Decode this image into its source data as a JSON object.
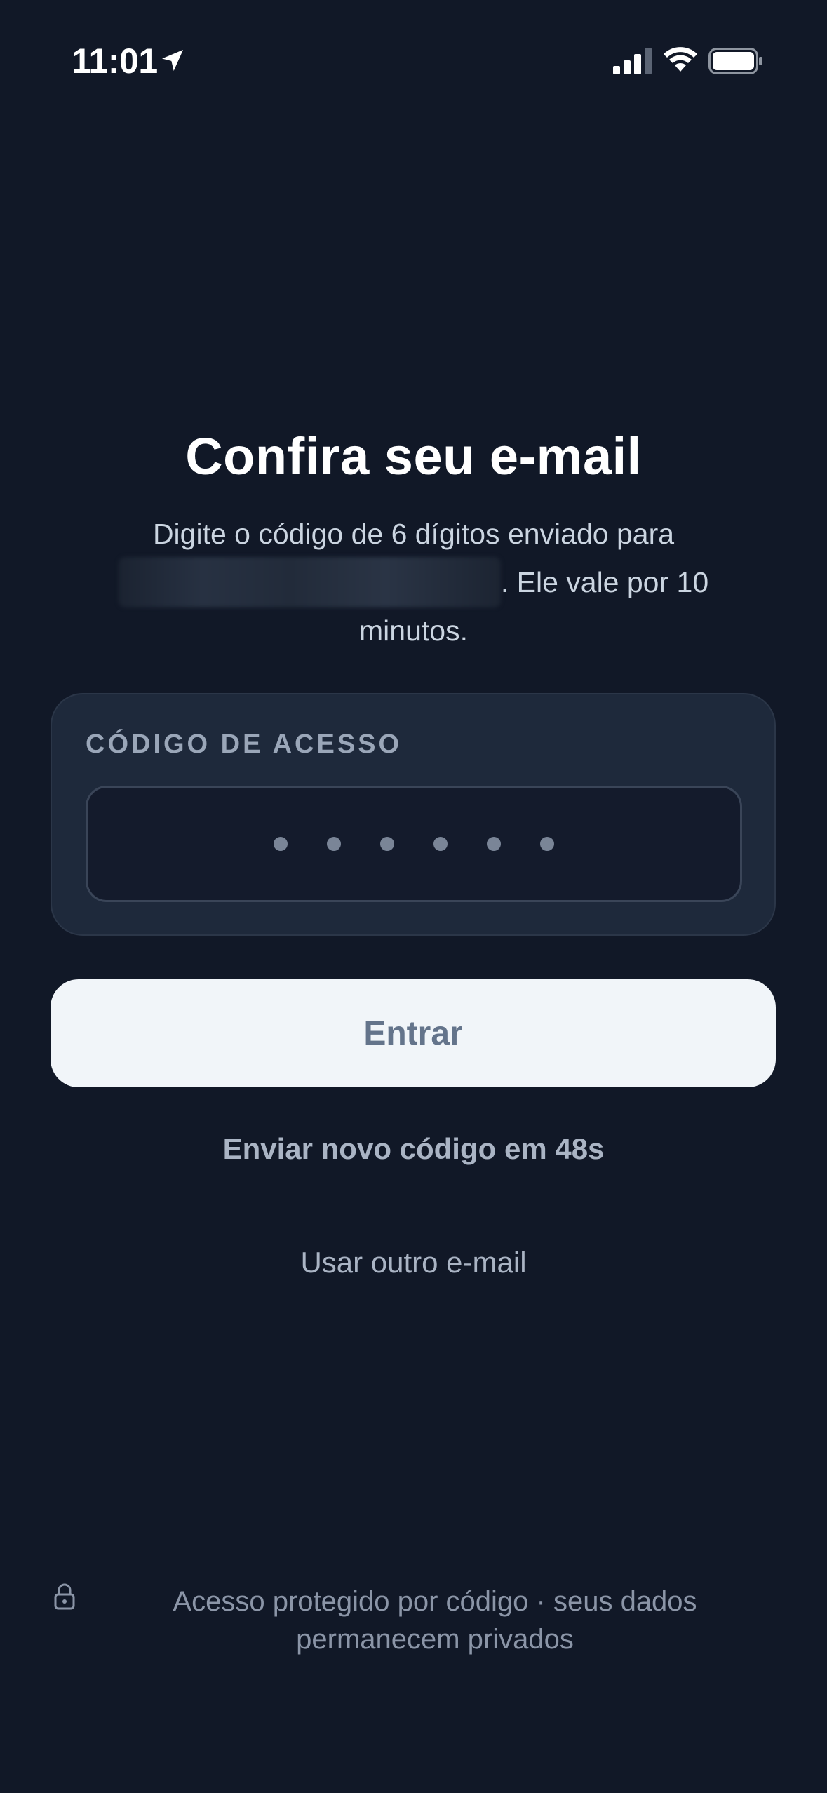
{
  "status_bar": {
    "time": "11:01",
    "icons": [
      "location-arrow-icon",
      "cellular-signal-icon",
      "wifi-icon",
      "battery-icon"
    ]
  },
  "title": "Confira seu e-mail",
  "subtitle": {
    "before_email": "Digite o código de 6 dígitos enviado para",
    "after_email": ". Ele vale por 10 minutos."
  },
  "code_card": {
    "label": "CÓDIGO DE ACESSO",
    "digit_count": 6
  },
  "buttons": {
    "submit": "Entrar",
    "resend": "Enviar novo código em 48s",
    "other_email": "Usar outro e-mail"
  },
  "footer": {
    "text": "Acesso protegido por código · seus dados permanecem privados",
    "icon": "lock-icon"
  },
  "colors": {
    "background": "#111827",
    "card": "#1E293B",
    "button_bg": "#F1F5F9",
    "button_text": "#64748B"
  }
}
